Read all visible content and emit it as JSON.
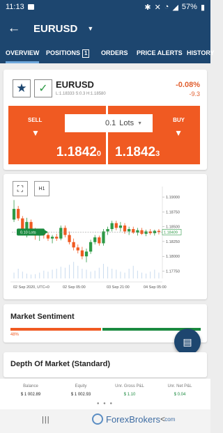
{
  "status": {
    "time": "11:13",
    "battery": "57%"
  },
  "header": {
    "back_icon": "arrow-left-icon",
    "title": "EURUSD"
  },
  "tabs": [
    {
      "label": "OVERVIEW",
      "active": true
    },
    {
      "label": "POSITIONS",
      "badge": "1"
    },
    {
      "label": "ORDERS"
    },
    {
      "label": "PRICE ALERTS"
    },
    {
      "label": "HISTORY"
    }
  ],
  "quote": {
    "symbol": "EURUSD",
    "subinfo": "L:1.18333   S:0.3   H:1.18580",
    "change_pct": "-0.08%",
    "change_pips": "-9.3",
    "sell_label": "SELL",
    "buy_label": "BUY",
    "sell_price": "1.1842",
    "sell_pip": "0",
    "buy_price": "1.1842",
    "buy_pip": "3",
    "lots_value": "0.1",
    "lots_unit": "Lots"
  },
  "chart_controls": {
    "timeframe": "H1",
    "position_tag": "0.10 Lots"
  },
  "chart_data": {
    "type": "candlestick",
    "title": "",
    "y_ticks": [
      "1.19000",
      "1.18750",
      "1.18500",
      "1.18250",
      "1.18000",
      "1.17750"
    ],
    "x_ticks": [
      "02 Sep 2020, UTC+0",
      "02 Sep 05:00",
      "03 Sep 21:00",
      "04 Sep 05:00"
    ],
    "current_price": "1.18409",
    "ylim": [
      1.1765,
      1.1913
    ],
    "colors": {
      "up": "#2e9a46",
      "down": "#f05a22"
    },
    "candles": [
      [
        1.1862,
        1.1895,
        1.1858,
        1.188
      ],
      [
        1.188,
        1.1885,
        1.186,
        1.1864
      ],
      [
        1.1864,
        1.1868,
        1.1835,
        1.184
      ],
      [
        1.184,
        1.1865,
        1.1832,
        1.1858
      ],
      [
        1.1858,
        1.1862,
        1.1836,
        1.1842
      ],
      [
        1.1842,
        1.1848,
        1.1828,
        1.1835
      ],
      [
        1.1835,
        1.1843,
        1.1826,
        1.1838
      ],
      [
        1.1838,
        1.1844,
        1.183,
        1.1836
      ],
      [
        1.1836,
        1.184,
        1.1826,
        1.183
      ],
      [
        1.183,
        1.1836,
        1.1822,
        1.1833
      ],
      [
        1.1833,
        1.1838,
        1.1826,
        1.183
      ],
      [
        1.183,
        1.1852,
        1.1827,
        1.1848
      ],
      [
        1.1848,
        1.1852,
        1.1832,
        1.1836
      ],
      [
        1.1836,
        1.1842,
        1.182,
        1.1824
      ],
      [
        1.1824,
        1.183,
        1.181,
        1.1815
      ],
      [
        1.1815,
        1.182,
        1.1805,
        1.181
      ],
      [
        1.181,
        1.1816,
        1.1795,
        1.18
      ],
      [
        1.18,
        1.1813,
        1.179,
        1.1808
      ],
      [
        1.1808,
        1.1828,
        1.1804,
        1.1824
      ],
      [
        1.1824,
        1.1836,
        1.182,
        1.1832
      ],
      [
        1.1832,
        1.1835,
        1.1818,
        1.1822
      ],
      [
        1.1822,
        1.1846,
        1.1818,
        1.1842
      ],
      [
        1.1842,
        1.185,
        1.1836,
        1.1846
      ],
      [
        1.1846,
        1.186,
        1.1842,
        1.1856
      ],
      [
        1.1856,
        1.186,
        1.1844,
        1.1848
      ],
      [
        1.1848,
        1.1858,
        1.1842,
        1.1852
      ],
      [
        1.1852,
        1.1856,
        1.1838,
        1.1842
      ],
      [
        1.1842,
        1.185,
        1.1836,
        1.1846
      ],
      [
        1.1846,
        1.185,
        1.1838,
        1.184
      ],
      [
        1.184,
        1.1848,
        1.1835,
        1.1844
      ],
      [
        1.1844,
        1.1848,
        1.1836,
        1.1838
      ],
      [
        1.1838,
        1.1845,
        1.1834,
        1.1842
      ],
      [
        1.1842,
        1.1846,
        1.1836,
        1.1839
      ],
      [
        1.1839,
        1.1845,
        1.1835,
        1.1843
      ],
      [
        1.1843,
        1.1846,
        1.1837,
        1.1841
      ]
    ],
    "volumes": [
      0.3,
      0.5,
      0.35,
      0.25,
      0.2,
      0.22,
      0.3,
      0.4,
      0.35,
      0.45,
      0.5,
      0.6,
      0.55,
      0.7,
      0.85,
      0.65,
      0.5,
      0.45,
      0.35,
      0.4,
      0.55,
      0.75,
      0.6,
      0.5,
      0.45,
      0.35,
      0.3,
      0.5,
      0.65,
      0.4,
      0.3,
      0.25,
      0.35,
      0.45,
      0.3
    ]
  },
  "sentiment": {
    "title": "Market Sentiment",
    "sell_pct": "48%",
    "sell_value": 48,
    "buy_value": 52
  },
  "depth": {
    "title": "Depth Of Market (Standard)"
  },
  "account": [
    {
      "label": "Balance",
      "value": "$ 1 002.89",
      "green": false
    },
    {
      "label": "Equity",
      "value": "$ 1 002.93",
      "green": false
    },
    {
      "label": "Unr. Gross P&L",
      "value": "$ 1.10",
      "green": true
    },
    {
      "label": "Unr. Net P&L",
      "value": "$ 0.04",
      "green": true
    }
  ],
  "watermark": {
    "brand": "ForexBrokers",
    "tld": ".com"
  }
}
